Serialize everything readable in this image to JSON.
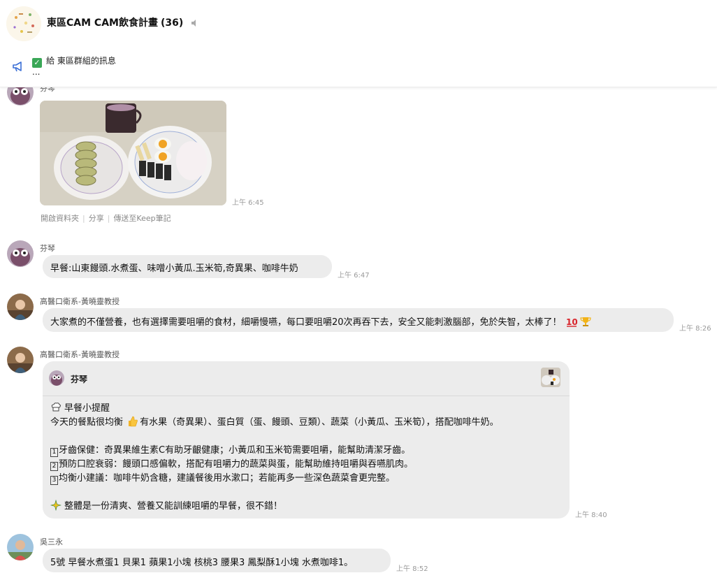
{
  "header": {
    "title": "東區CAM CAM飲食計畫",
    "member_count": "(36)"
  },
  "announcement": {
    "text": "給 東區群組的訊息",
    "ellipsis": "..."
  },
  "photo_message": {
    "sender": "芬琴",
    "time": "上午 6:45",
    "links": [
      "開啟資料夾",
      "分享",
      "傳送至Keep筆記"
    ]
  },
  "messages": [
    {
      "sender": "芬琴",
      "text": "早餐:山東饅頭.水煮蛋、味噌小黃瓜.玉米筍,奇異果、咖啡牛奶",
      "time": "上午 6:47"
    },
    {
      "sender": "高醫口衛系-黃曉靈教授",
      "text": "大家煮的不僅營養，也有選擇需要咀嚼的食材，細嚼慢嚥，每口要咀嚼20次再吞下去，安全又能刺激腦部，免於失智，太棒了！",
      "time": "上午 8:26"
    }
  ],
  "reply_message": {
    "sender": "高醫口衛系-黃曉靈教授",
    "quoted_name": "芬琴",
    "time": "上午 8:40",
    "title": "早餐小提醒",
    "line1": "今天的餐點很均衡",
    "line1_rest": "有水果（奇異果）、蛋白質（蛋、饅頭、豆類）、蔬菜（小黃瓜、玉米筍），搭配咖啡牛奶。",
    "points": [
      {
        "num": "1",
        "text": "牙齒保健：奇異果維生素C有助牙齦健康；小黃瓜和玉米筍需要咀嚼，能幫助清潔牙齒。"
      },
      {
        "num": "2",
        "text": "預防口腔衰弱：饅頭口感偏軟，搭配有咀嚼力的蔬菜與蛋，能幫助維持咀嚼與吞嚥肌肉。"
      },
      {
        "num": "3",
        "text": "均衡小建議：咖啡牛奶含糖，建議餐後用水漱口；若能再多一些深色蔬菜會更完整。"
      }
    ],
    "closing": "整體是一份清爽、營養又能訓練咀嚼的早餐，很不錯！"
  },
  "last_message": {
    "sender": "吳三永",
    "text": "5號 早餐水煮蛋1 貝果1 蘋果1小塊 核桃3 腰果3 鳳梨酥1小塊 水煮咖啡1。",
    "time": "上午 8:52"
  },
  "icons": {
    "mute": "speaker-muted-icon",
    "announcement": "megaphone-icon",
    "check": "green-check-icon",
    "thumbs_up": "thumbs-up-icon",
    "reply_title": "chef-hat-icon",
    "closing": "sparkle-icon",
    "reaction1": "hundred-points-icon",
    "reaction2": "trophy-icon"
  },
  "colors": {
    "bubble": "#ececec",
    "check": "#3aa757",
    "announce_icon": "#3b6fd6"
  }
}
